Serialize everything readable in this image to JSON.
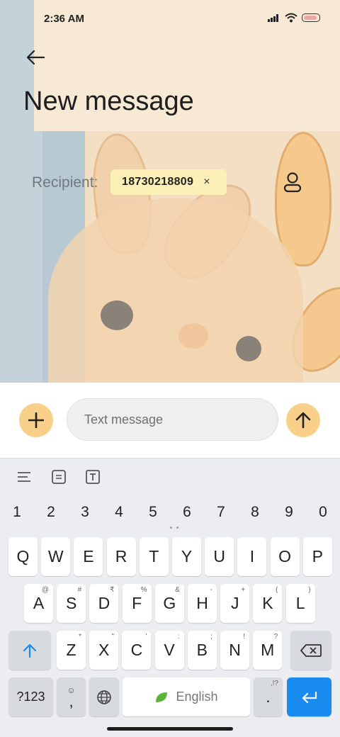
{
  "status_bar": {
    "time": "2:36 AM",
    "icons": [
      "signal-icon",
      "wifi-icon",
      "battery-icon"
    ]
  },
  "header": {
    "back_icon": "arrow-left-icon",
    "title": "New message"
  },
  "recipient": {
    "label": "Recipient:",
    "chip_number": "18730218809",
    "chip_remove": "×",
    "contact_icon": "person-icon"
  },
  "compose": {
    "add_icon": "plus-icon",
    "placeholder": "Text message",
    "send_icon": "arrow-up-icon"
  },
  "colors": {
    "accent": "#f8d08a",
    "chip_bg": "#fdf0b7",
    "keyboard_bg": "#ebedf0",
    "enter_key": "#1a8cf0"
  },
  "keyboard": {
    "toolbar": [
      "lines-icon",
      "document-icon",
      "text-box-icon"
    ],
    "numbers": [
      "1",
      "2",
      "3",
      "4",
      "5",
      "6",
      "7",
      "8",
      "9",
      "0"
    ],
    "row1": [
      "Q",
      "W",
      "E",
      "R",
      "T",
      "Y",
      "U",
      "I",
      "O",
      "P"
    ],
    "row2": [
      {
        "k": "A",
        "h": "@"
      },
      {
        "k": "S",
        "h": "#"
      },
      {
        "k": "D",
        "h": "₹"
      },
      {
        "k": "F",
        "h": "%"
      },
      {
        "k": "G",
        "h": "&"
      },
      {
        "k": "H",
        "h": "-"
      },
      {
        "k": "J",
        "h": "+"
      },
      {
        "k": "K",
        "h": "("
      },
      {
        "k": "L",
        "h": ")"
      }
    ],
    "row3": [
      {
        "k": "Z",
        "h": "*"
      },
      {
        "k": "X",
        "h": "\""
      },
      {
        "k": "C",
        "h": "'"
      },
      {
        "k": "V",
        "h": ":"
      },
      {
        "k": "B",
        "h": ";"
      },
      {
        "k": "N",
        "h": "!"
      },
      {
        "k": "M",
        "h": "?"
      }
    ],
    "symbols_label": "?123",
    "comma_label": ",",
    "space_label": "English",
    "period_label": ".",
    "period_hint": ",!?"
  }
}
